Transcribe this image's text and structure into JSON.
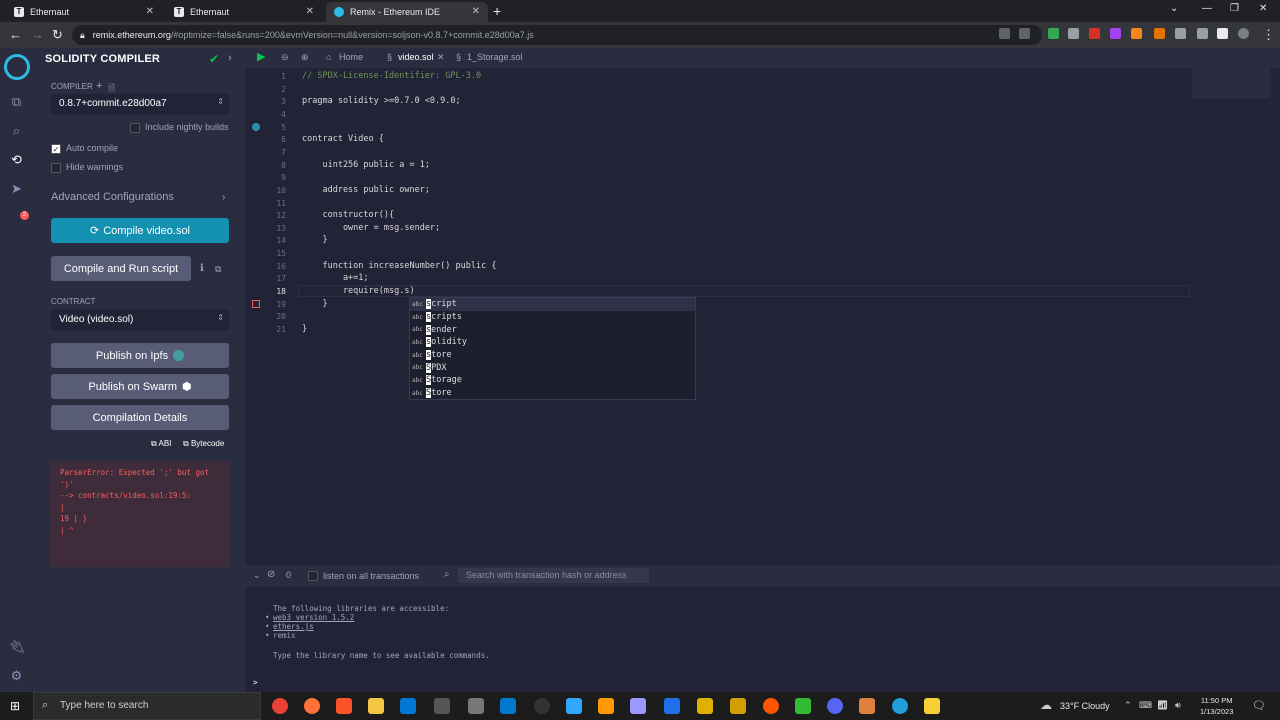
{
  "browser": {
    "tabs": [
      {
        "label": "Ethernaut",
        "active": false
      },
      {
        "label": "Ethernaut",
        "active": false
      },
      {
        "label": "Remix - Ethereum IDE",
        "active": true
      }
    ],
    "address": {
      "domain": "remix.ethereum.org",
      "path": "/#optimize=false&runs=200&evmVersion=null&version=soljson-v0.8.7+commit.e28d00a7.js"
    }
  },
  "sidepanel": {
    "title": "SOLIDITY COMPILER",
    "compiler_label": "COMPILER",
    "compiler_version": "0.8.7+commit.e28d00a7",
    "include_nightly": "Include nightly builds",
    "auto_compile": "Auto compile",
    "hide_warnings": "Hide warnings",
    "advanced": "Advanced Configurations",
    "compile_button": "Compile video.sol",
    "compile_run_button": "Compile and Run script",
    "contract_label": "CONTRACT",
    "contract_value": "Video (video.sol)",
    "publish_ipfs": "Publish on Ipfs",
    "publish_swarm": "Publish on Swarm",
    "compilation_details": "Compilation Details",
    "abi": "ABI",
    "bytecode": "Bytecode",
    "error_lines": [
      "ParserError: Expected ';' but got",
      "')'",
      "--> contracts/video.sol:19:5:",
      "|",
      "19 | }",
      "| ^"
    ]
  },
  "editor": {
    "tabs": [
      "Home",
      "video.sol",
      "1_Storage.sol"
    ],
    "current_line": "18",
    "lines": [
      {
        "n": "1",
        "text": "// SPDX-License-Identifier: GPL-3.0"
      },
      {
        "n": "2",
        "text": ""
      },
      {
        "n": "3",
        "text": "pragma solidity >=0.7.0 <0.9.0;"
      },
      {
        "n": "4",
        "text": ""
      },
      {
        "n": "5",
        "text": ""
      },
      {
        "n": "6",
        "text": "contract Video {"
      },
      {
        "n": "7",
        "text": ""
      },
      {
        "n": "8",
        "text": "    uint256 public a = 1;"
      },
      {
        "n": "9",
        "text": ""
      },
      {
        "n": "10",
        "text": "    address public owner;"
      },
      {
        "n": "11",
        "text": ""
      },
      {
        "n": "12",
        "text": "    constructor(){"
      },
      {
        "n": "13",
        "text": "        owner = msg.sender;"
      },
      {
        "n": "14",
        "text": "    }"
      },
      {
        "n": "15",
        "text": ""
      },
      {
        "n": "16",
        "text": "    function increaseNumber() public {"
      },
      {
        "n": "17",
        "text": "        a+=1;"
      },
      {
        "n": "18",
        "text": "        require(msg.s)"
      },
      {
        "n": "19",
        "text": "    }"
      },
      {
        "n": "20",
        "text": ""
      },
      {
        "n": "21",
        "text": "}"
      }
    ],
    "autocomplete": [
      {
        "kind": "abc",
        "first": "s",
        "rest": "cript"
      },
      {
        "kind": "abc",
        "first": "s",
        "rest": "cripts"
      },
      {
        "kind": "abc",
        "first": "s",
        "rest": "ender"
      },
      {
        "kind": "abc",
        "first": "s",
        "rest": "olidity"
      },
      {
        "kind": "abc",
        "first": "s",
        "rest": "tore"
      },
      {
        "kind": "abc",
        "first": "S",
        "rest": "PDX"
      },
      {
        "kind": "abc",
        "first": "S",
        "rest": "torage"
      },
      {
        "kind": "abc",
        "first": "S",
        "rest": "tore"
      }
    ]
  },
  "terminal": {
    "count": "0",
    "listen_label": "listen on all transactions",
    "search_placeholder": "Search with transaction hash or address",
    "lines": [
      {
        "text": "The following libraries are accessible:",
        "u": false
      },
      {
        "text": "web3 version 1.5.2",
        "u": true,
        "bullet": true
      },
      {
        "text": "ethers.js",
        "u": true,
        "bullet": true
      },
      {
        "text": "remix",
        "u": false,
        "bullet": true
      },
      {
        "text": "",
        "u": false
      },
      {
        "text": "Type the library name to see available commands.",
        "u": false
      }
    ],
    "prompt": ">"
  },
  "taskbar": {
    "search_placeholder": "Type here to search",
    "weather": "33°F  Cloudy",
    "time": "11:50 PM",
    "date": "1/13/2023"
  }
}
